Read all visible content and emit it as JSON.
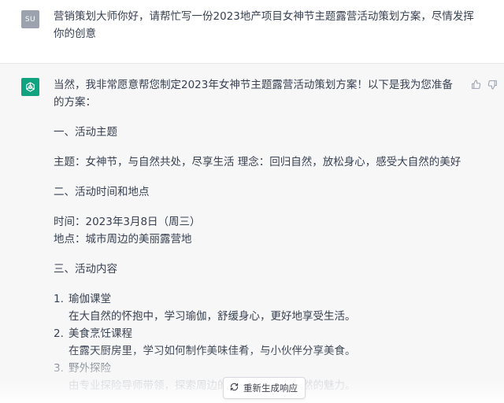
{
  "user": {
    "avatar": "SU",
    "message": "营销策划大师你好，请帮忙写一份2023地产项目女神节主题露营活动策划方案，尽情发挥你的创意"
  },
  "assistant": {
    "avatar_icon": "openai-logo-icon",
    "intro": "当然，我非常愿意帮您制定2023年女神节主题露营活动策划方案！以下是我为您准备的方案：",
    "section1_heading": "一、活动主题",
    "theme_line": "主题：女神节，与自然共处，尽享生活 理念：回归自然，放松身心，感受大自然的美好",
    "section2_heading": "二、活动时间和地点",
    "time_line": "时间：2023年3月8日（周三）",
    "place_line": "地点：城市周边的美丽露营地",
    "section3_heading": "三、活动内容",
    "items": [
      {
        "num": "1.",
        "title": "瑜伽课堂",
        "desc": "在大自然的怀抱中，学习瑜伽，舒缓身心，更好地享受生活。"
      },
      {
        "num": "2.",
        "title": "美食烹饪课程",
        "desc": "在露天厨房里，学习如何制作美味佳肴，与小伙伴分享美食。"
      },
      {
        "num": "3.",
        "title": "野外探险",
        "desc": "由专业探险导师带领，探索周边的山林，感受大自然的魅力。"
      }
    ],
    "thumbs_up_icon": "thumbs-up-icon",
    "thumbs_down_icon": "thumbs-down-icon"
  },
  "regenerate": {
    "icon": "refresh-icon",
    "label": "重新生成响应"
  },
  "colors": {
    "assistant_bg": "#f7f7f8",
    "user_avatar": "#9ca3af",
    "bot_avatar": "#10a37f",
    "text": "#374151"
  }
}
